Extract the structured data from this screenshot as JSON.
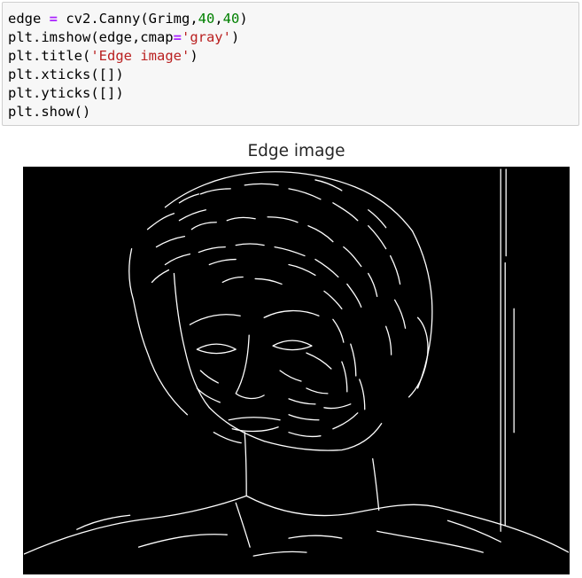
{
  "code_cell": {
    "lines": [
      [
        {
          "t": "edge ",
          "k": "plain"
        },
        {
          "t": "=",
          "k": "op"
        },
        {
          "t": " cv2.Canny(Grimg,",
          "k": "plain"
        },
        {
          "t": "40",
          "k": "num"
        },
        {
          "t": ",",
          "k": "plain"
        },
        {
          "t": "40",
          "k": "num"
        },
        {
          "t": ")",
          "k": "plain"
        }
      ],
      [
        {
          "t": "plt.imshow(edge,cmap",
          "k": "plain"
        },
        {
          "t": "=",
          "k": "op"
        },
        {
          "t": "'gray'",
          "k": "str"
        },
        {
          "t": ")",
          "k": "plain"
        }
      ],
      [
        {
          "t": "plt.title(",
          "k": "plain"
        },
        {
          "t": "'Edge image'",
          "k": "str"
        },
        {
          "t": ")",
          "k": "plain"
        }
      ],
      [
        {
          "t": "plt.xticks([])",
          "k": "plain"
        }
      ],
      [
        {
          "t": "plt.yticks([])",
          "k": "plain"
        }
      ],
      [
        {
          "t": "plt.show()",
          "k": "plain"
        }
      ]
    ]
  },
  "output": {
    "title": "Edge image",
    "image_description_icon": "edge-detected-portrait"
  },
  "colors": {
    "code_background": "#f7f7f7",
    "operator": "#aa22ff",
    "number": "#008000",
    "string": "#ba2121",
    "image_background": "#000000",
    "edge_stroke": "#ffffff"
  }
}
